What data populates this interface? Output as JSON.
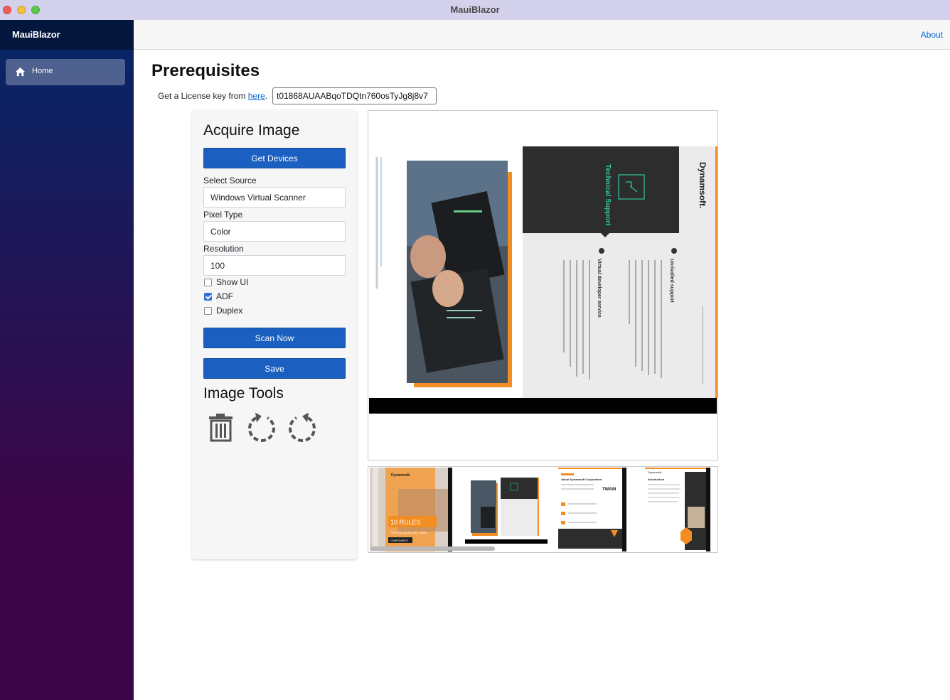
{
  "window": {
    "title": "MauiBlazor"
  },
  "sidebar": {
    "brand": "MauiBlazor",
    "items": [
      {
        "label": "Home",
        "icon": "home-icon",
        "active": true
      }
    ]
  },
  "topbar": {
    "about_label": "About"
  },
  "main": {
    "title": "Prerequisites",
    "license": {
      "prefix": "Get a License key from ",
      "link_text": "here",
      "suffix": ".",
      "key_value": "t01868AUAABqoTDQtn760osTyJg8j8v7"
    }
  },
  "acquire": {
    "title": "Acquire Image",
    "get_devices_label": "Get Devices",
    "select_source_label": "Select Source",
    "select_source_value": "Windows Virtual Scanner",
    "pixel_type_label": "Pixel Type",
    "pixel_type_value": "Color",
    "resolution_label": "Resolution",
    "resolution_value": "100",
    "options": [
      {
        "label": "Show UI",
        "checked": false
      },
      {
        "label": "ADF",
        "checked": true
      },
      {
        "label": "Duplex",
        "checked": false
      }
    ],
    "scan_now_label": "Scan Now",
    "save_label": "Save"
  },
  "tools": {
    "title": "Image Tools",
    "icons": [
      "trash-icon",
      "rotate-left-icon",
      "rotate-right-icon"
    ]
  },
  "preview": {
    "brand": "Dynamsoft.",
    "panel_heading": "Technical Support",
    "section_1_title": "Unrivalled support",
    "section_2_title": "Virtual developer service"
  },
  "thumbnails": {
    "cover_brand": "Dynamsoft.",
    "cover_title": "10 RULES",
    "cover_subtitle": "FOR EVALUATING WEB TWAIN",
    "cover_footer": "COMPONENTS",
    "page3_title": "About Dynamsoft Corporation",
    "page3_logo": "TWAIN",
    "page4_title": "Introduction"
  },
  "colors": {
    "accent_blue": "#1b5fc1",
    "link_blue": "#0366d6",
    "orange": "#f7941d",
    "dark_panel": "#2d2d2d",
    "teal": "#2ec4a0"
  }
}
